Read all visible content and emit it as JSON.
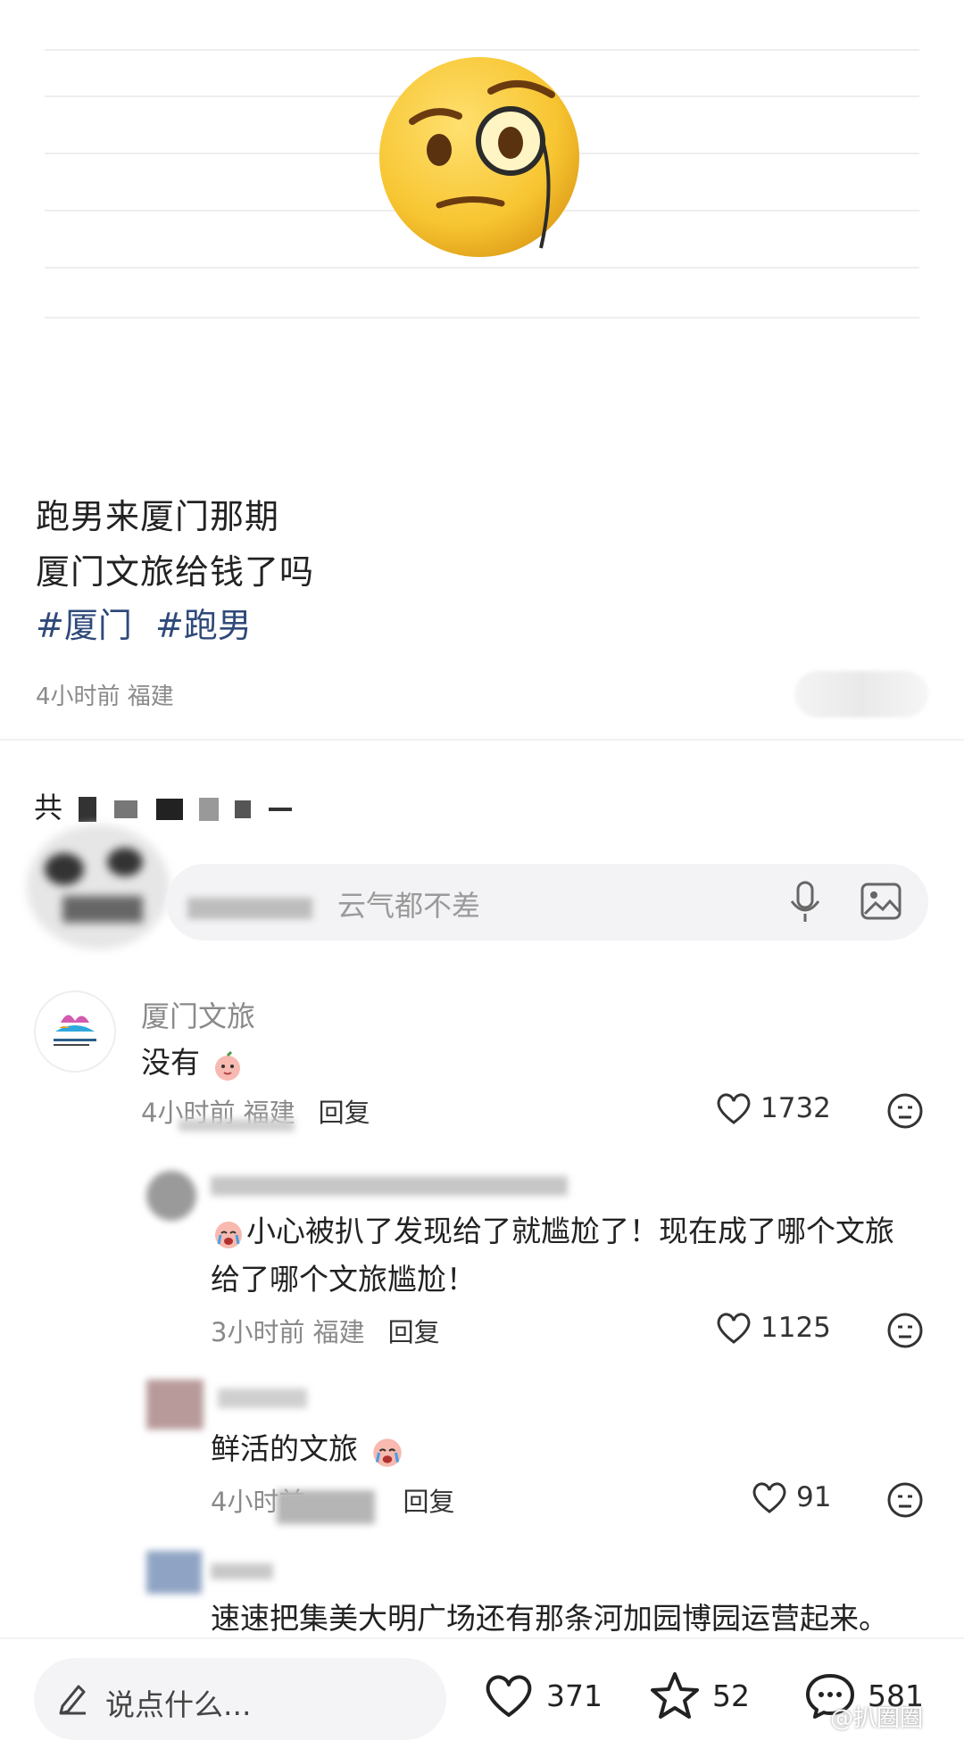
{
  "post": {
    "line1": "跑男来厦门那期",
    "line2": "厦门文旅给钱了吗",
    "tags": [
      "#厦门",
      "#跑男"
    ],
    "meta": "4小时前 福建"
  },
  "comments_header": {
    "prefix": "共"
  },
  "input": {
    "placeholder": "云气都不差"
  },
  "comments": [
    {
      "name": "厦门文旅",
      "text": "没有",
      "meta": "4小时前 福建",
      "reply": "回复",
      "likes": "1732"
    },
    {
      "name": "",
      "text": "小心被扒了发现给了就尴尬了！现在成了哪个文旅",
      "text2": "给了哪个文旅尴尬！",
      "meta": "3小时前 福建",
      "reply": "回复",
      "likes": "1125"
    },
    {
      "name": "",
      "text": "鲜活的文旅",
      "meta": "4小时前",
      "reply": "回复",
      "likes": "91"
    },
    {
      "name": "",
      "text": "速速把集美大明广场还有那条河加园博园运营起来。"
    }
  ],
  "bottom_bar": {
    "say_placeholder": "说点什么...",
    "likes": "371",
    "favorites": "52",
    "comments": "581"
  },
  "watermark": "@扒圈圈",
  "colors": {
    "tag": "#2f4a7a",
    "muted": "#8a8a8a",
    "emoji_yellow": "#f7c531"
  }
}
